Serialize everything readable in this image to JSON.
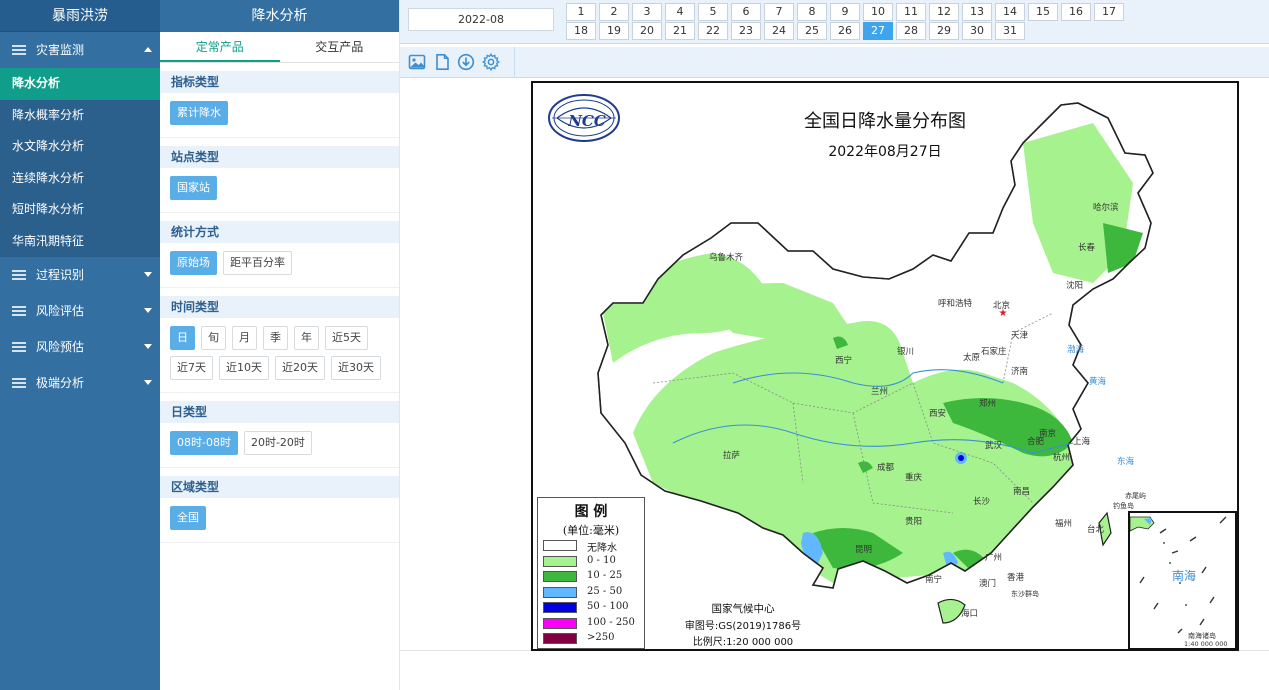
{
  "sidebar": {
    "brand": "暴雨洪涝",
    "groups": [
      {
        "label": "灾害监测",
        "open": true,
        "items": [
          "降水分析",
          "降水概率分析",
          "水文降水分析",
          "连续降水分析",
          "短时降水分析",
          "华南汛期特征"
        ]
      },
      {
        "label": "过程识别"
      },
      {
        "label": "风险评估"
      },
      {
        "label": "风险预估"
      },
      {
        "label": "极端分析"
      }
    ],
    "active_item": "降水分析"
  },
  "panel": {
    "title": "降水分析",
    "tabs": [
      "定常产品",
      "交互产品"
    ],
    "sections": [
      {
        "title": "指标类型",
        "options": [
          "累计降水"
        ],
        "selected": [
          0
        ]
      },
      {
        "title": "站点类型",
        "options": [
          "国家站"
        ],
        "selected": [
          0
        ]
      },
      {
        "title": "统计方式",
        "options": [
          "原始场",
          "距平百分率"
        ],
        "selected": [
          0
        ]
      },
      {
        "title": "时间类型",
        "options": [
          "日",
          "旬",
          "月",
          "季",
          "年",
          "近5天",
          "近7天",
          "近10天",
          "近20天",
          "近30天"
        ],
        "selected": [
          0
        ]
      },
      {
        "title": "日类型",
        "options": [
          "08时-08时",
          "20时-20时"
        ],
        "selected": [
          0
        ]
      },
      {
        "title": "区域类型",
        "options": [
          "全国"
        ],
        "selected": [
          0
        ]
      }
    ]
  },
  "datebar": {
    "month": "2022-08",
    "days": [
      "1",
      "2",
      "3",
      "4",
      "5",
      "6",
      "7",
      "8",
      "9",
      "10",
      "11",
      "12",
      "13",
      "14",
      "15",
      "16",
      "17",
      "18",
      "19",
      "20",
      "21",
      "22",
      "23",
      "24",
      "25",
      "26",
      "27",
      "28",
      "29",
      "30",
      "31"
    ],
    "selected_day": "27"
  },
  "toolbar": {
    "icons": [
      "image-icon",
      "document-icon",
      "download-icon",
      "settings-icon"
    ]
  },
  "map": {
    "title": "全国日降水量分布图",
    "date": "2022年08月27日",
    "logo_text": "中国 NCC",
    "legend": {
      "title": "图 例",
      "unit": "(单位:毫米)",
      "entries": [
        {
          "label": "无降水",
          "color": "#ffffff"
        },
        {
          "label": "0 - 10",
          "color": "#a6f28f"
        },
        {
          "label": "10 - 25",
          "color": "#3db83d"
        },
        {
          "label": "25 - 50",
          "color": "#61b8ff"
        },
        {
          "label": "50 - 100",
          "color": "#0000e1"
        },
        {
          "label": "100 - 250",
          "color": "#fa00fa"
        },
        {
          "label": ">250",
          "color": "#800040"
        }
      ]
    },
    "credit": {
      "org": "国家气候中心",
      "review": "审图号:GS(2019)1786号",
      "scale": "比例尺:1:20 000 000"
    },
    "inset": {
      "label": "南海",
      "caption": "南海诸岛",
      "scale": "1:40 000 000"
    },
    "cities": [
      "哈尔滨",
      "长春",
      "沈阳",
      "乌鲁木齐",
      "呼和浩特",
      "北京",
      "天津",
      "石家庄",
      "太原",
      "银川",
      "西宁",
      "兰州",
      "济南",
      "郑州",
      "西安",
      "合肥",
      "南京",
      "上海",
      "武汉",
      "成都",
      "重庆",
      "拉萨",
      "长沙",
      "南昌",
      "杭州",
      "福州",
      "台北",
      "贵阳",
      "昆明",
      "南宁",
      "广州",
      "香港",
      "澳门",
      "海口"
    ],
    "sea_labels": [
      "渤海",
      "黄海",
      "东海",
      "钓鱼岛",
      "赤尾屿",
      "东沙群岛"
    ]
  }
}
